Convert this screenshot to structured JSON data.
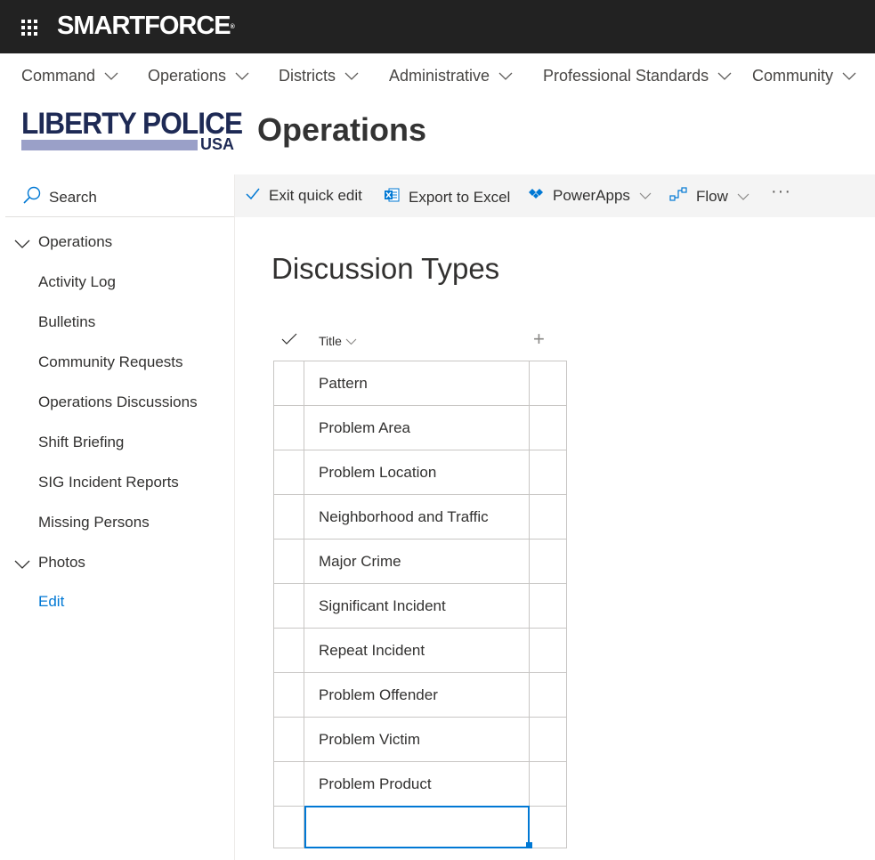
{
  "suite_bar": {
    "brand": "SMARTFORCE",
    "brand_mark": "®"
  },
  "hub_nav": {
    "items": [
      {
        "label": "Command"
      },
      {
        "label": "Operations"
      },
      {
        "label": "Districts"
      },
      {
        "label": "Administrative"
      },
      {
        "label": "Professional Standards"
      },
      {
        "label": "Community"
      }
    ]
  },
  "site_header": {
    "logo_main": "LIBERTY POLICE",
    "logo_sub": "USA",
    "title": "Operations",
    "logo_colors": {
      "text": "#1e2a55",
      "bar": "#9aa0c8"
    }
  },
  "left_nav": {
    "search_label": "Search",
    "items": [
      {
        "label": "Operations",
        "expanded": true
      },
      {
        "label": "Activity Log"
      },
      {
        "label": "Bulletins"
      },
      {
        "label": "Community Requests"
      },
      {
        "label": "Operations Discussions"
      },
      {
        "label": "Shift Briefing"
      },
      {
        "label": "SIG Incident Reports"
      },
      {
        "label": "Missing Persons"
      },
      {
        "label": "Photos",
        "expanded": true
      },
      {
        "label": "Edit"
      }
    ]
  },
  "command_bar": {
    "exit_quick_edit": "Exit quick edit",
    "export_to_excel": "Export to Excel",
    "powerapps": "PowerApps",
    "flow": "Flow",
    "more": "···"
  },
  "main": {
    "page_title": "Discussion Types",
    "column_header": "Title",
    "add_column": "+",
    "rows": [
      "Pattern",
      "Problem Area",
      "Problem Location",
      "Neighborhood and Traffic",
      "Major Crime",
      "Significant Incident",
      "Repeat Incident",
      "Problem Offender",
      "Problem Victim",
      "Problem Product",
      ""
    ]
  },
  "colors": {
    "suite_bar": "#222222",
    "accent": "#0078d4",
    "command_bar": "#f4f4f4",
    "excel_green": "#217346"
  }
}
